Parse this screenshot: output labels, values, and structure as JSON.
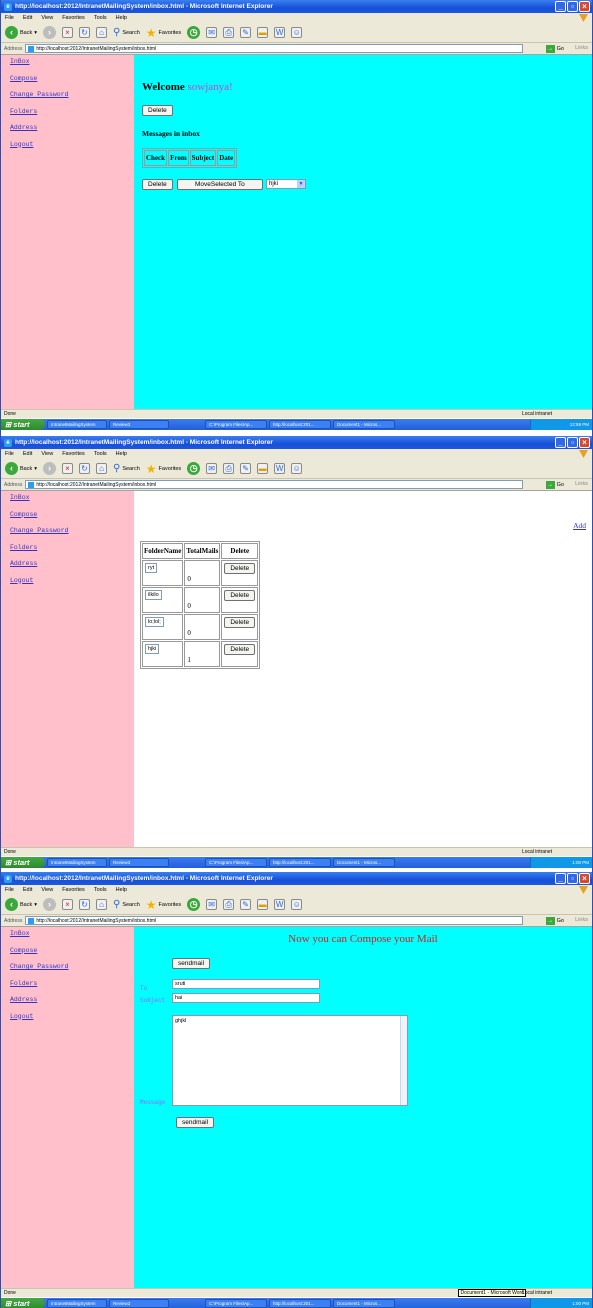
{
  "browser": {
    "title": "http://localhost:2012/IntranetMailingSystem/inbox.html - Microsoft Internet Explorer",
    "menu": [
      "File",
      "Edit",
      "View",
      "Favorites",
      "Tools",
      "Help"
    ],
    "toolbar": {
      "back": "Back",
      "search": "Search",
      "favorites": "Favorites"
    },
    "address_label": "Address",
    "address": "http://localhost:2012/IntranetMailingSystem/inbox.html",
    "go_label": "Go",
    "links_label": "Links",
    "status_done": "Done",
    "status_zone": "Local intranet"
  },
  "taskbar": {
    "start": "start",
    "tasks": [
      "IntranetMailingSystem",
      "Review3",
      "C:\\Program Files\\Ap...",
      "http://localhost:201...",
      "Document1 - Micros..."
    ],
    "times": [
      "12:59 PM",
      "1:00 PM",
      "1:00 PM"
    ],
    "tooltip": "Document1 - Microsoft Word"
  },
  "sidebar": [
    "InBox",
    "Compose",
    "Change Password",
    "Folders",
    "Address",
    "Logout"
  ],
  "inbox": {
    "welcome": "Welcome",
    "username": "sowjanya!",
    "delete_label": "Delete",
    "messages_heading": "Messages in inbox",
    "columns": [
      "Check",
      "From",
      "Subject",
      "Date"
    ],
    "move_label": "MoveSelected To",
    "folder_select": "hjki"
  },
  "folders": {
    "add_label": "Add",
    "columns": [
      "FolderName",
      "TotalMails",
      "Delete"
    ],
    "rows": [
      {
        "name": "ryt",
        "total": "0",
        "delete": "Delete"
      },
      {
        "name": "ilkilo",
        "total": "0",
        "delete": "Delete"
      },
      {
        "name": "lo;lol;",
        "total": "0",
        "delete": "Delete"
      },
      {
        "name": "hjki",
        "total": "1",
        "delete": "Delete"
      }
    ]
  },
  "compose": {
    "heading": "Now you can Compose your Mail",
    "send_label": "sendmail",
    "to_label": "To",
    "to_value": "sruti",
    "subject_label": "Subject",
    "subject_value": "hai",
    "message_label": "Message",
    "message_value": "ghjkl"
  },
  "colors": {
    "sidebar": "#ffc0cb",
    "main": "#00ffff",
    "heading_red": "#cc2222",
    "username": "#cc44cc",
    "label_purple": "#9966ff"
  }
}
